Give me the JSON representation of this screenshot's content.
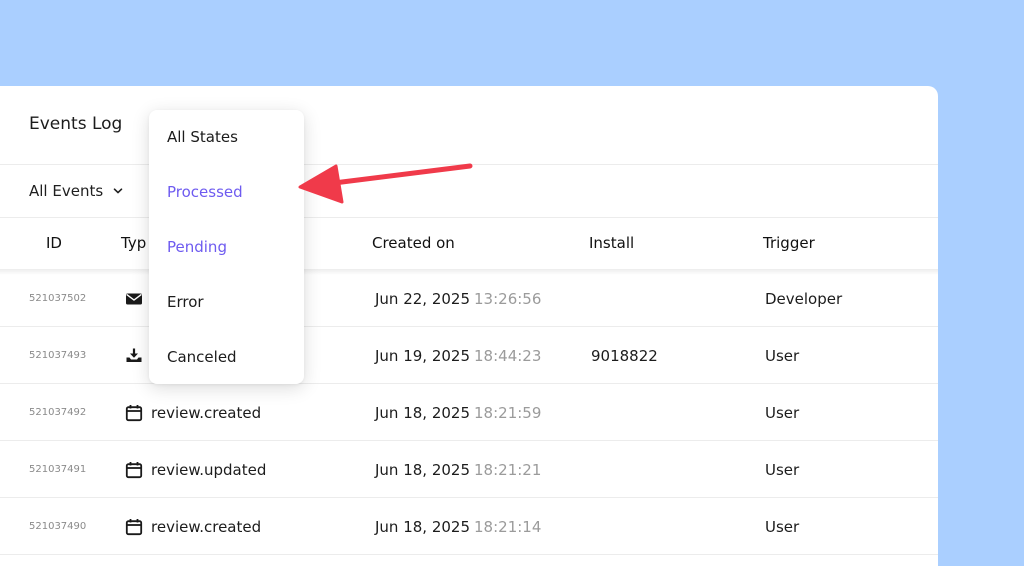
{
  "panel": {
    "title": "Events Log"
  },
  "filter": {
    "label": "All Events"
  },
  "columns": [
    "ID",
    "Typ",
    "Created on",
    "Install",
    "Trigger"
  ],
  "dropdown": {
    "items": [
      {
        "label": "All States",
        "accent": false
      },
      {
        "label": "Processed",
        "accent": true
      },
      {
        "label": "Pending",
        "accent": true
      },
      {
        "label": "Error",
        "accent": false
      },
      {
        "label": "Canceled",
        "accent": false
      }
    ]
  },
  "rows": [
    {
      "id": "521037502",
      "icon": "envelope-icon",
      "type": "",
      "date": "Jun 22, 2025",
      "time": "13:26:56",
      "install": "",
      "trigger": "Developer"
    },
    {
      "id": "521037493",
      "icon": "download-icon",
      "type": "",
      "date": "Jun 19, 2025",
      "time": "18:44:23",
      "install": "9018822",
      "trigger": "User"
    },
    {
      "id": "521037492",
      "icon": "calendar-icon",
      "type": "review.created",
      "date": "Jun 18, 2025",
      "time": "18:21:59",
      "install": "",
      "trigger": "User"
    },
    {
      "id": "521037491",
      "icon": "calendar-icon",
      "type": "review.updated",
      "date": "Jun 18, 2025",
      "time": "18:21:21",
      "install": "",
      "trigger": "User"
    },
    {
      "id": "521037490",
      "icon": "calendar-icon",
      "type": "review.created",
      "date": "Jun 18, 2025",
      "time": "18:21:14",
      "install": "",
      "trigger": "User"
    }
  ],
  "colors": {
    "accent": "#6e5bf0",
    "arrow": "#f03a4a",
    "background": "#aacfff"
  }
}
